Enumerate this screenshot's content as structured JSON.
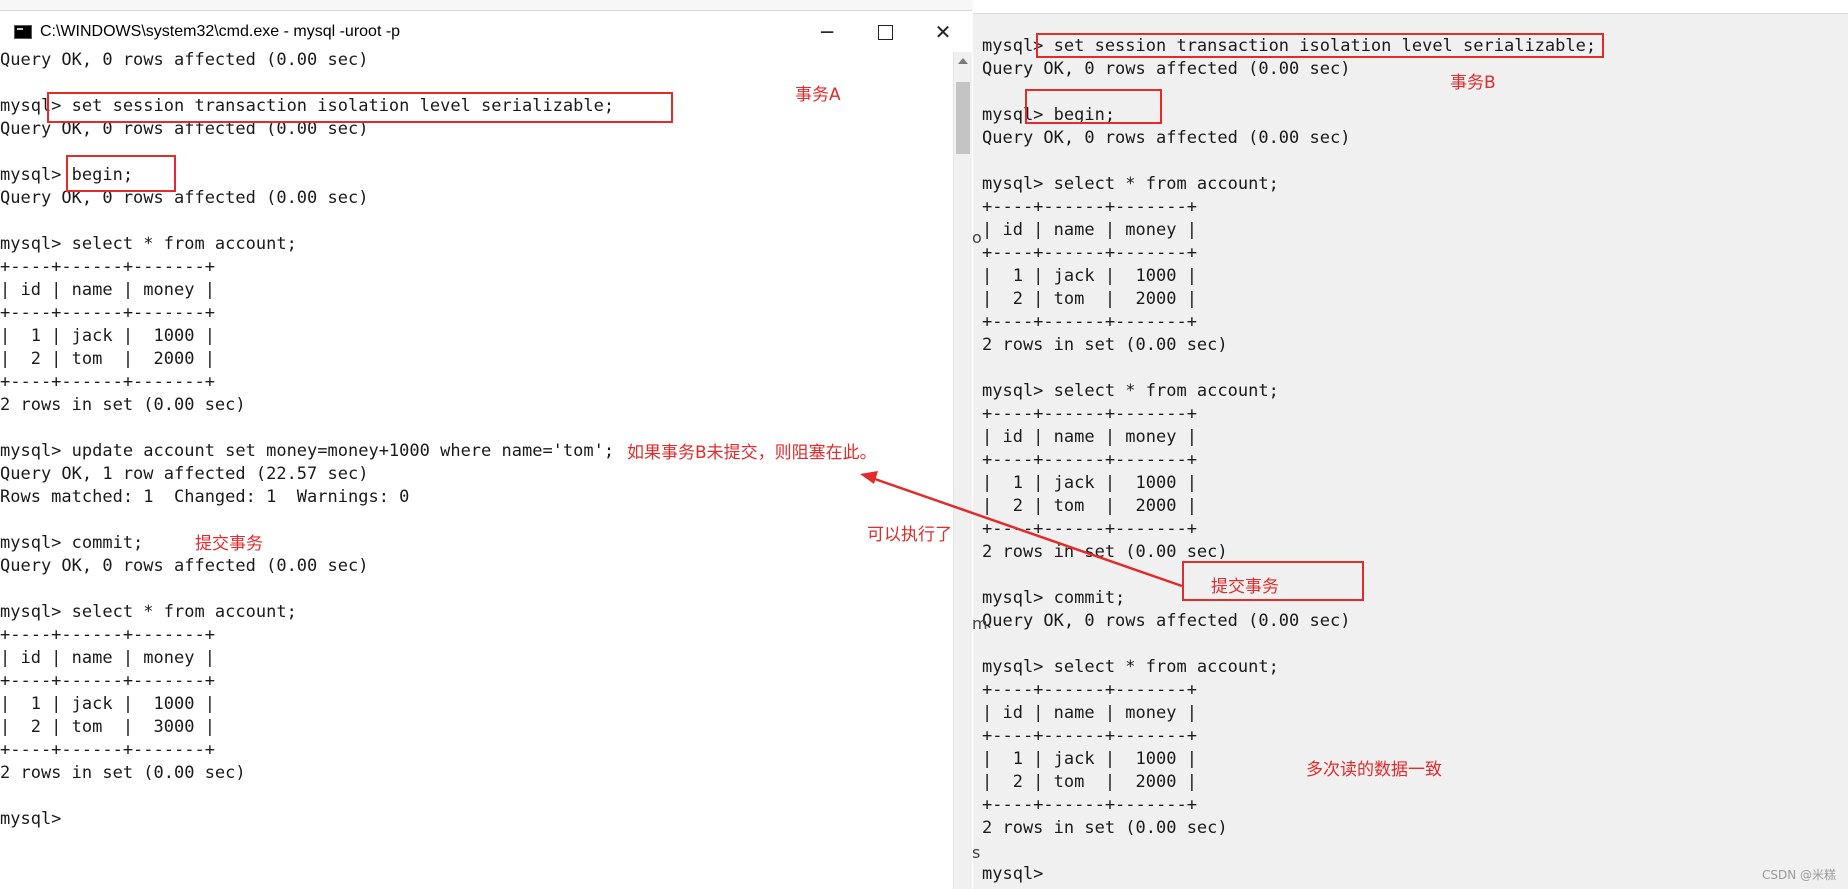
{
  "left_window": {
    "title": "C:\\WINDOWS\\system32\\cmd.exe - mysql  -uroot -p",
    "minimize_label": "─",
    "close_label": "✕",
    "icon": "console-icon",
    "terminal_text": "Query OK, 0 rows affected (0.00 sec)\n\nmysql> set session transaction isolation level serializable;\nQuery OK, 0 rows affected (0.00 sec)\n\nmysql> begin;\nQuery OK, 0 rows affected (0.00 sec)\n\nmysql> select * from account;\n+----+------+-------+\n| id | name | money |\n+----+------+-------+\n|  1 | jack |  1000 |\n|  2 | tom  |  2000 |\n+----+------+-------+\n2 rows in set (0.00 sec)\n\nmysql> update account set money=money+1000 where name='tom';\nQuery OK, 1 row affected (22.57 sec)\nRows matched: 1  Changed: 1  Warnings: 0\n\nmysql> commit;\nQuery OK, 0 rows affected (0.00 sec)\n\nmysql> select * from account;\n+----+------+-------+\n| id | name | money |\n+----+------+-------+\n|  1 | jack |  1000 |\n|  2 | tom  |  3000 |\n+----+------+-------+\n2 rows in set (0.00 sec)\n\nmysql> "
  },
  "right_window": {
    "terminal_text": "mysql> set session transaction isolation level serializable;\nQuery OK, 0 rows affected (0.00 sec)\n\nmysql> begin;\nQuery OK, 0 rows affected (0.00 sec)\n\nmysql> select * from account;\n+----+------+-------+\n| id | name | money |\n+----+------+-------+\n|  1 | jack |  1000 |\n|  2 | tom  |  2000 |\n+----+------+-------+\n2 rows in set (0.00 sec)\n\nmysql> select * from account;\n+----+------+-------+\n| id | name | money |\n+----+------+-------+\n|  1 | jack |  1000 |\n|  2 | tom  |  2000 |\n+----+------+-------+\n2 rows in set (0.00 sec)\n\nmysql> commit;\nQuery OK, 0 rows affected (0.00 sec)\n\nmysql> select * from account;\n+----+------+-------+\n| id | name | money |\n+----+------+-------+\n|  1 | jack |  1000 |\n|  2 | tom  |  2000 |\n+----+------+-------+\n2 rows in set (0.00 sec)\n\nmysql> "
  },
  "annotations": {
    "transaction_a": "事务A",
    "transaction_b": "事务B",
    "blocked_note": "如果事务B未提交，则阻塞在此。",
    "commit_note_left": "提交事务",
    "can_execute_note": "可以执行了",
    "commit_note_right": "提交事务",
    "consistent_reads_note": "多次读的数据一致"
  },
  "watermark": "CSDN @米糕",
  "edge_glyphs": [
    "o",
    "m",
    "s"
  ],
  "colors": {
    "annotation_red": "#e22b2b",
    "terminal_text": "#1a1a1a",
    "left_background": "#ffffff",
    "right_background": "#f0f0f0"
  }
}
